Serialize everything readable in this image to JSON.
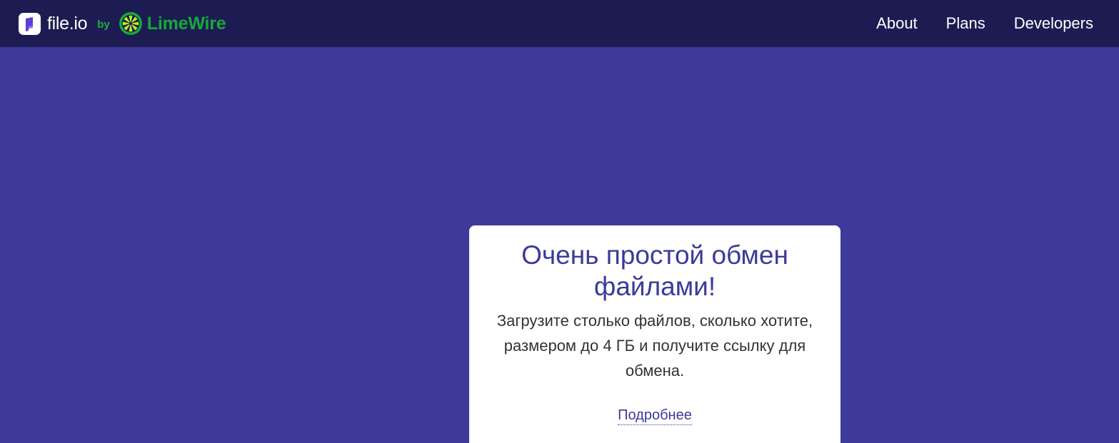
{
  "navbar": {
    "brand": {
      "logo_icon": "file-io-logo-icon",
      "name": "file.io",
      "by": "by",
      "partner_icon": "limewire-icon",
      "partner_name": "LimeWire"
    },
    "links": [
      {
        "label": "About"
      },
      {
        "label": "Plans"
      },
      {
        "label": "Developers"
      }
    ]
  },
  "hero": {
    "title": "Очень простой обмен файлами!",
    "subtitle": "Загрузите столько файлов, сколько хотите, размером до 4 ГБ и получите ссылку для обмена.",
    "learn_more": "Подробнее"
  },
  "colors": {
    "navbar_bg": "#1d1c52",
    "page_bg": "#3d3a9a",
    "accent": "#3d3a9a",
    "limewire_green": "#16a83a"
  }
}
